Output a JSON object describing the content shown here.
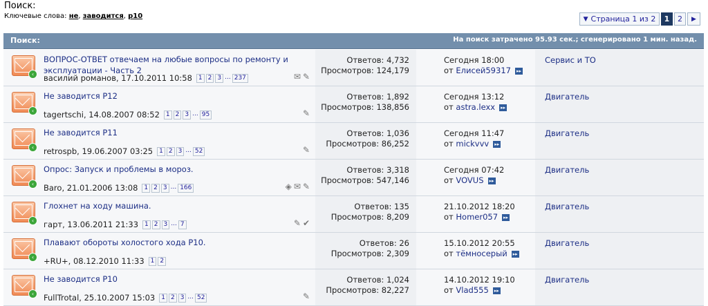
{
  "page": {
    "title": "Поиск:",
    "keywords_label": "Ключевые слова:",
    "keywords": [
      "не",
      "заводится",
      "p10"
    ]
  },
  "pager": {
    "label": "Страница 1 из 2",
    "pages": [
      "1",
      "2"
    ],
    "current": "1"
  },
  "header": {
    "title": "Поиск:",
    "info": "На поиск затрачено 95.93 сек.; сгенерировано 1 мин. назад."
  },
  "threads": [
    {
      "title": "ВОПРОС-ОТВЕТ отвечаем на любые вопросы по ремонту и эксплуатации - Часть 2",
      "meta": "василий романов, 17.10.2011 10:58",
      "pages": [
        "1",
        "2",
        "3"
      ],
      "last_page": "237",
      "replies": "Ответов: 4,732",
      "views": "Просмотров: 124,179",
      "last_time": "Сегодня 18:00",
      "last_user": "Елисей59317",
      "forum": "Сервис и ТО",
      "icons": [
        "envelope-icon",
        "paperclip-icon"
      ]
    },
    {
      "title": "Не заводится Р12",
      "meta": "tagertschi, 14.08.2007 08:52",
      "pages": [
        "1",
        "2",
        "3"
      ],
      "last_page": "95",
      "replies": "Ответов: 1,892",
      "views": "Просмотров: 138,856",
      "last_time": "Сегодня 13:12",
      "last_user": "astra.lexx",
      "forum": "Двигатель",
      "icons": [
        "paperclip-icon"
      ]
    },
    {
      "title": "Не заводится P11",
      "meta": "retrospb, 19.06.2007 03:25",
      "pages": [
        "1",
        "2",
        "3"
      ],
      "last_page": "52",
      "replies": "Ответов: 1,036",
      "views": "Просмотров: 86,252",
      "last_time": "Сегодня 11:47",
      "last_user": "mickvvv",
      "forum": "Двигатель",
      "icons": [
        "paperclip-icon"
      ]
    },
    {
      "title": "Опрос: Запуск и проблемы в мороз.",
      "meta": "Baro, 21.01.2006 13:08",
      "pages": [
        "1",
        "2",
        "3"
      ],
      "last_page": "166",
      "replies": "Ответов: 3,318",
      "views": "Просмотров: 547,146",
      "last_time": "Сегодня 07:42",
      "last_user": "VOVUS",
      "forum": "Двигатель",
      "icons": [
        "tag-icon",
        "envelope-icon",
        "paperclip-icon"
      ]
    },
    {
      "title": "Глохнет на ходу машина.",
      "meta": "гарт, 13.06.2011 21:33",
      "pages": [
        "1",
        "2",
        "3"
      ],
      "last_page": "7",
      "replies": "Ответов: 135",
      "views": "Просмотров: 8,209",
      "last_time": "21.10.2012 18:20",
      "last_user": "Homer057",
      "forum": "Двигатель",
      "icons": [
        "paperclip-icon",
        "check-icon"
      ]
    },
    {
      "title": "Плавают обороты холостого хода Р10.",
      "meta": "+RU+, 08.12.2010 11:33",
      "pages": [
        "1",
        "2"
      ],
      "last_page": "",
      "replies": "Ответов: 26",
      "views": "Просмотров: 2,309",
      "last_time": "15.10.2012 20:55",
      "last_user": "тёмносерый",
      "forum": "Двигатель",
      "icons": []
    },
    {
      "title": "Не заводится P10",
      "meta": "FullTrotal, 25.10.2007 15:03",
      "pages": [
        "1",
        "2",
        "3"
      ],
      "last_page": "52",
      "replies": "Ответов: 1,024",
      "views": "Просмотров: 82,227",
      "last_time": "14.10.2012 19:10",
      "last_user": "Vlad555",
      "forum": "Двигатель",
      "icons": [
        "paperclip-icon"
      ]
    }
  ],
  "labels": {
    "from": "от",
    "ellipsis": "..."
  }
}
